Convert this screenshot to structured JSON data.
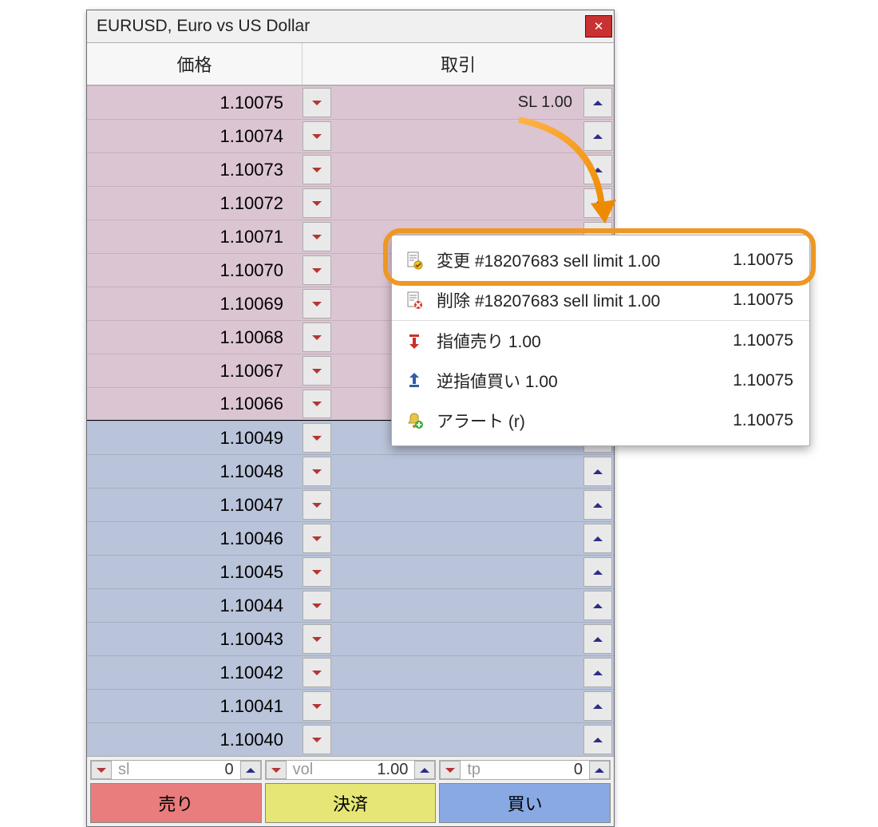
{
  "window": {
    "title": "EURUSD, Euro vs US Dollar"
  },
  "headers": {
    "price": "価格",
    "trade": "取引"
  },
  "rows": [
    {
      "price": "1.10075",
      "side": "ask",
      "label": "SL 1.00"
    },
    {
      "price": "1.10074",
      "side": "ask",
      "label": ""
    },
    {
      "price": "1.10073",
      "side": "ask",
      "label": ""
    },
    {
      "price": "1.10072",
      "side": "ask",
      "label": ""
    },
    {
      "price": "1.10071",
      "side": "ask",
      "label": ""
    },
    {
      "price": "1.10070",
      "side": "ask",
      "label": ""
    },
    {
      "price": "1.10069",
      "side": "ask",
      "label": ""
    },
    {
      "price": "1.10068",
      "side": "ask",
      "label": ""
    },
    {
      "price": "1.10067",
      "side": "ask",
      "label": ""
    },
    {
      "price": "1.10066",
      "side": "ask",
      "label": "",
      "last_ask": true
    },
    {
      "price": "1.10049",
      "side": "bid",
      "label": ""
    },
    {
      "price": "1.10048",
      "side": "bid",
      "label": ""
    },
    {
      "price": "1.10047",
      "side": "bid",
      "label": ""
    },
    {
      "price": "1.10046",
      "side": "bid",
      "label": ""
    },
    {
      "price": "1.10045",
      "side": "bid",
      "label": ""
    },
    {
      "price": "1.10044",
      "side": "bid",
      "label": ""
    },
    {
      "price": "1.10043",
      "side": "bid",
      "label": ""
    },
    {
      "price": "1.10042",
      "side": "bid",
      "label": ""
    },
    {
      "price": "1.10041",
      "side": "bid",
      "label": ""
    },
    {
      "price": "1.10040",
      "side": "bid",
      "label": ""
    }
  ],
  "inputs": {
    "sl": {
      "label": "sl",
      "value": "0"
    },
    "vol": {
      "label": "vol",
      "value": "1.00"
    },
    "tp": {
      "label": "tp",
      "value": "0"
    }
  },
  "actions": {
    "sell": "売り",
    "close": "決済",
    "buy": "買い"
  },
  "menu": {
    "items": [
      {
        "icon": "doc-edit",
        "label": "変更 #18207683 sell limit 1.00",
        "value": "1.10075"
      },
      {
        "icon": "doc-delete",
        "label": "削除 #18207683 sell limit 1.00",
        "value": "1.10075",
        "sep": true
      },
      {
        "icon": "arrow-down-red",
        "label": "指値売り 1.00",
        "value": "1.10075"
      },
      {
        "icon": "arrow-up-blue",
        "label": "逆指値買い 1.00",
        "value": "1.10075"
      },
      {
        "icon": "bell-add",
        "label": "アラート (r)",
        "value": "1.10075"
      }
    ]
  }
}
